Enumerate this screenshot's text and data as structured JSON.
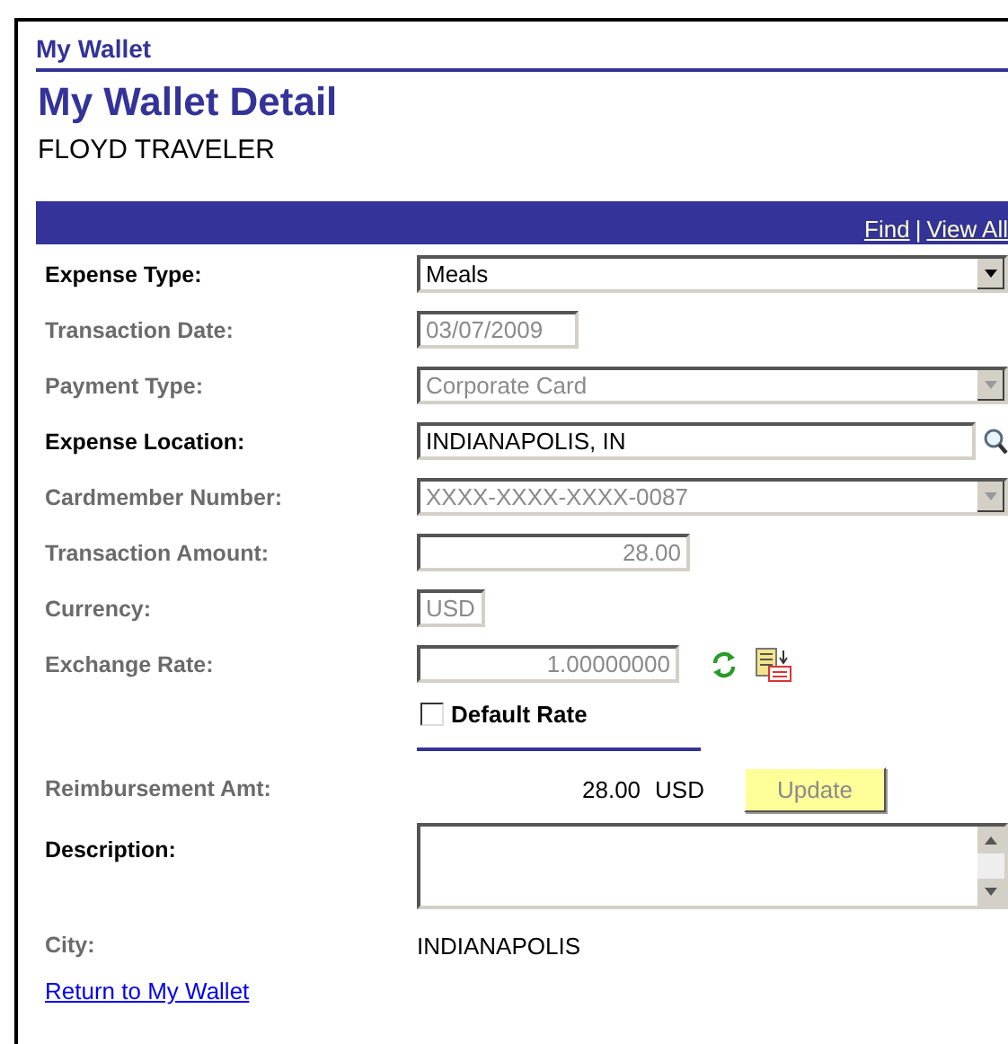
{
  "breadcrumb": "My Wallet",
  "title": "My Wallet Detail",
  "employee": "FLOYD TRAVELER",
  "grid_links": [
    {
      "label": "Find"
    },
    {
      "label": "View All"
    }
  ],
  "grid_link_separator": "|",
  "fields": [
    {
      "label": "Expense Type:",
      "kind": "dropdown",
      "value": "Meals",
      "disabled": false
    },
    {
      "label": "Transaction Date:",
      "kind": "text",
      "value": "03/07/2009",
      "disabled": true
    },
    {
      "label": "Payment Type:",
      "kind": "dropdown",
      "value": "Corporate Card",
      "disabled": true
    },
    {
      "label": "Expense Location:",
      "kind": "lookup",
      "value": "INDIANAPOLIS, IN",
      "disabled": false
    },
    {
      "label": "Cardmember Number:",
      "kind": "dropdown",
      "value": "XXXX-XXXX-XXXX-0087",
      "disabled": true
    },
    {
      "label": "Transaction Amount:",
      "kind": "amount",
      "value": "28.00",
      "disabled": true
    },
    {
      "label": "Currency:",
      "kind": "code",
      "value": "USD",
      "disabled": true
    },
    {
      "label": "Exchange Rate:",
      "kind": "rate",
      "value": "1.00000000",
      "disabled": true
    }
  ],
  "default_rate": {
    "label": "Default Rate",
    "checked": false
  },
  "reimbursement": {
    "label": "Reimbursement Amt:",
    "amount": "28.00",
    "currency": "USD",
    "button": "Update",
    "button_disabled": true
  },
  "description": {
    "label": "Description:"
  },
  "city": {
    "label": "City:",
    "value": "INDIANAPOLIS"
  },
  "return_link": "Return to My Wallet"
}
